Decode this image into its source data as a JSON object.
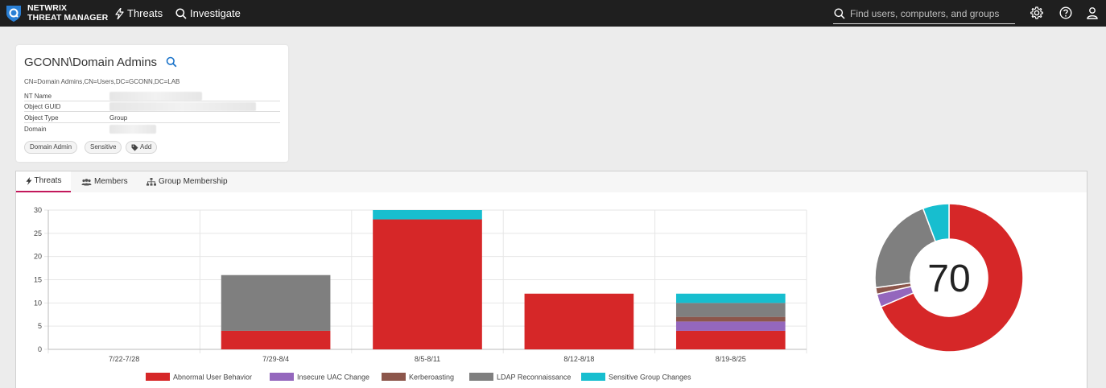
{
  "header": {
    "brand_line1": "NETWRIX",
    "brand_line2": "THREAT MANAGER",
    "nav": [
      {
        "label": "Threats",
        "icon": "bolt-icon"
      },
      {
        "label": "Investigate",
        "icon": "search-icon"
      }
    ],
    "search_placeholder": "Find users, computers, and groups",
    "icons": [
      "gear-icon",
      "help-icon",
      "user-icon"
    ]
  },
  "object": {
    "title": "GCONN\\Domain Admins",
    "dn": "CN=Domain Admins,CN=Users,DC=GCONN,DC=LAB",
    "properties": [
      {
        "key": "NT Name",
        "value": ""
      },
      {
        "key": "Object GUID",
        "value": ""
      },
      {
        "key": "Object Type",
        "value": "Group"
      },
      {
        "key": "Domain",
        "value": ""
      }
    ],
    "tags": [
      "Domain Admin",
      "Sensitive"
    ],
    "add_tag_label": "Add"
  },
  "tabs": [
    {
      "label": "Threats",
      "active": true
    },
    {
      "label": "Members",
      "active": false
    },
    {
      "label": "Group Membership",
      "active": false
    }
  ],
  "colors": {
    "abnormal": "#d62728",
    "uac": "#9467bd",
    "kerberoasting": "#8c564b",
    "ldap": "#7f7f7f",
    "sensitive": "#17becf",
    "active_tab": "#c2185b"
  },
  "chart_data": [
    {
      "type": "bar",
      "stacked": true,
      "categories": [
        "7/22-7/28",
        "7/29-8/4",
        "8/5-8/11",
        "8/12-8/18",
        "8/19-8/25"
      ],
      "series": [
        {
          "name": "Abnormal User Behavior",
          "color": "#d62728",
          "values": [
            0,
            4,
            28,
            12,
            4
          ]
        },
        {
          "name": "Insecure UAC Change",
          "color": "#9467bd",
          "values": [
            0,
            0,
            0,
            0,
            2
          ]
        },
        {
          "name": "Kerberoasting",
          "color": "#8c564b",
          "values": [
            0,
            0,
            0,
            0,
            1
          ]
        },
        {
          "name": "LDAP Reconnaissance",
          "color": "#7f7f7f",
          "values": [
            0,
            12,
            0,
            0,
            3
          ]
        },
        {
          "name": "Sensitive Group Changes",
          "color": "#17becf",
          "values": [
            0,
            0,
            2,
            0,
            2
          ]
        }
      ],
      "yticks": [
        "0",
        "5",
        "10",
        "15",
        "20",
        "25",
        "30"
      ],
      "ylim": [
        0,
        30
      ],
      "grid": true,
      "legend": "bottom"
    },
    {
      "type": "pie",
      "donut": true,
      "center_label": "70",
      "slices": [
        {
          "name": "Abnormal User Behavior",
          "color": "#d62728",
          "value": 48
        },
        {
          "name": "Insecure UAC Change",
          "color": "#9467bd",
          "value": 2
        },
        {
          "name": "Kerberoasting",
          "color": "#8c564b",
          "value": 1
        },
        {
          "name": "LDAP Reconnaissance",
          "color": "#7f7f7f",
          "value": 15
        },
        {
          "name": "Sensitive Group Changes",
          "color": "#17becf",
          "value": 4
        }
      ]
    }
  ]
}
